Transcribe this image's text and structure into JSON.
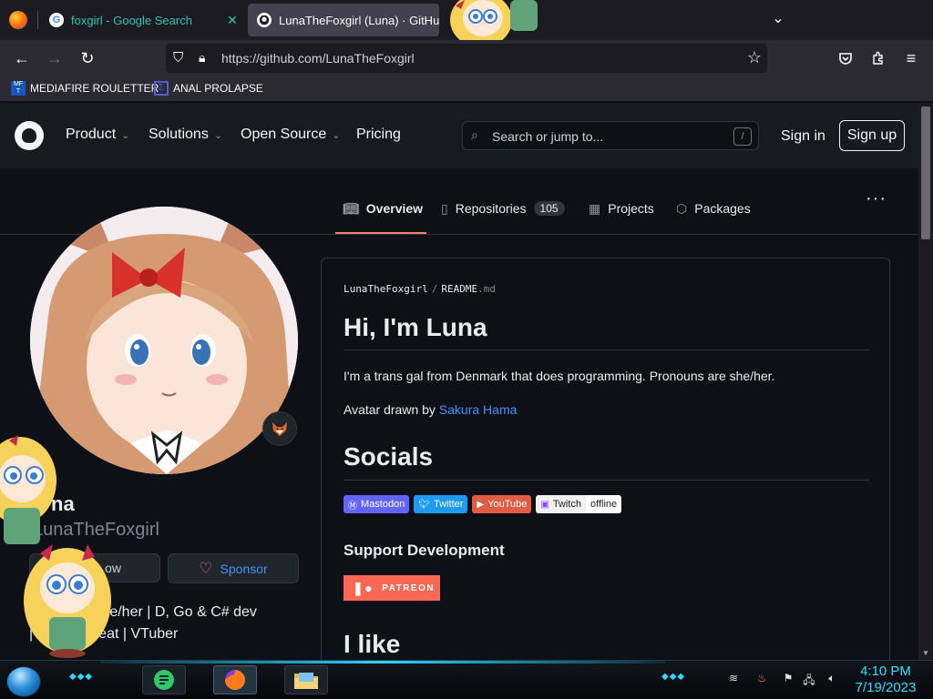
{
  "browser": {
    "tabs": [
      {
        "title": "foxgirl - Google Search",
        "favicon": "G"
      },
      {
        "title": "LunaTheFoxgirl (Luna) · GitHub"
      }
    ],
    "close_glyph": "✕",
    "url": "https://github.com/LunaTheFoxgirl",
    "bookmarks": [
      {
        "label": "MEDIAFIRE ROULETTER",
        "icon_text": "MF T"
      },
      {
        "label": "ANAL PROLAPSE"
      }
    ]
  },
  "github": {
    "nav": {
      "product": "Product",
      "solutions": "Solutions",
      "open_source": "Open Source",
      "pricing": "Pricing"
    },
    "search_placeholder": "Search or jump to...",
    "search_key": "/",
    "sign_in": "Sign in",
    "sign_up": "Sign up"
  },
  "profile": {
    "tabs": {
      "overview": "Overview",
      "repositories": "Repositories",
      "repositories_count": "105",
      "projects": "Projects",
      "packages": "Packages"
    },
    "name_visible": "na",
    "login_visible": "LunaTheFoxgirl",
    "follow_visible": "ow",
    "sponsor": "Sponsor",
    "bio_line1": "T         n | she/her | D, Go & C# dev",
    "bio_line2": "|          p great | VTuber"
  },
  "readme": {
    "path_user": "LunaTheFoxgirl",
    "path_sep": "/",
    "path_file": "README",
    "path_ext": ".md",
    "heading": "Hi, I'm Luna",
    "intro": "I'm a trans gal from Denmark that does programming. Pronouns are she/her.",
    "avatar_credit_prefix": "Avatar drawn by ",
    "avatar_credit_link": "Sakura Hama",
    "socials_heading": "Socials",
    "badges": {
      "mastodon": "Mastodon",
      "twitter": "Twitter",
      "youtube": "YouTube",
      "twitch": "Twitch",
      "twitch_status": "offline"
    },
    "support_heading": "Support Development",
    "patreon": "PATREON",
    "like_heading": "I like"
  },
  "taskbar": {
    "time": "4:10 PM",
    "date": "7/19/2023"
  }
}
